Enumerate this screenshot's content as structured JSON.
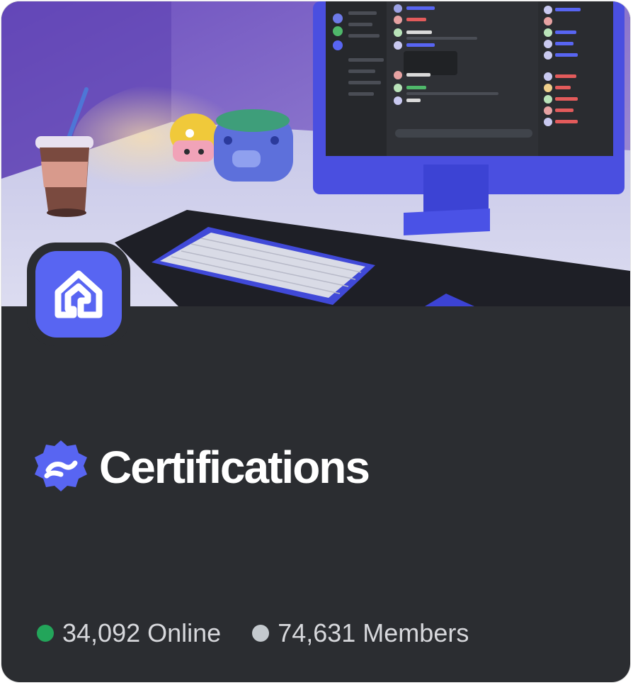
{
  "server": {
    "name": "Certifications",
    "badge_icon": "partner-badge-icon",
    "server_icon": "home-icon",
    "banner": "desk-setup-illustration"
  },
  "stats": {
    "online_text": "34,092 Online",
    "members_text": "74,631 Members"
  },
  "colors": {
    "card_background": "#2b2d31",
    "accent": "#5865f2",
    "online_dot": "#23a55a",
    "members_dot": "#c4c9ce",
    "stat_text": "#d7d8dc",
    "title_text": "#ffffff"
  }
}
